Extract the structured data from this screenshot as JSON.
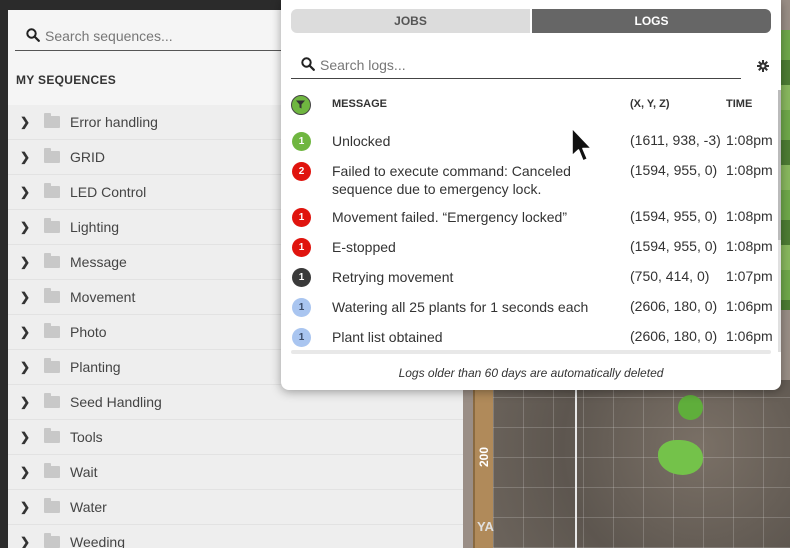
{
  "sequences": {
    "search_placeholder": "Search sequences...",
    "title": "MY SEQUENCES",
    "folders": [
      {
        "label": "Error handling"
      },
      {
        "label": "GRID"
      },
      {
        "label": "LED Control"
      },
      {
        "label": "Lighting"
      },
      {
        "label": "Message"
      },
      {
        "label": "Movement"
      },
      {
        "label": "Photo"
      },
      {
        "label": "Planting"
      },
      {
        "label": "Seed Handling"
      },
      {
        "label": "Tools"
      },
      {
        "label": "Wait"
      },
      {
        "label": "Water"
      },
      {
        "label": "Weeding"
      }
    ]
  },
  "map": {
    "axis_label": "200",
    "corner_label": "YA"
  },
  "logs_popup": {
    "tabs": {
      "jobs": "JOBS",
      "logs": "LOGS"
    },
    "active_tab": "logs",
    "search_placeholder": "Search logs...",
    "columns": {
      "message": "MESSAGE",
      "position": "(X, Y, Z)",
      "time": "TIME"
    },
    "rows": [
      {
        "level": "success",
        "verbosity": "1",
        "message": "Unlocked",
        "position": "(1611, 938, -3)",
        "time": "1:08pm"
      },
      {
        "level": "error",
        "verbosity": "2",
        "message": "Failed to execute command: Canceled sequence due to emergency lock.",
        "position": "(1594, 955, 0)",
        "time": "1:08pm"
      },
      {
        "level": "error",
        "verbosity": "1",
        "message": "Movement failed. “Emergency locked”",
        "position": "(1594, 955, 0)",
        "time": "1:08pm"
      },
      {
        "level": "error",
        "verbosity": "1",
        "message": "E-stopped",
        "position": "(1594, 955, 0)",
        "time": "1:08pm"
      },
      {
        "level": "busy",
        "verbosity": "1",
        "message": "Retrying movement",
        "position": "(750, 414, 0)",
        "time": "1:07pm"
      },
      {
        "level": "info",
        "verbosity": "1",
        "message": "Watering all 25 plants for 1 seconds each",
        "position": "(2606, 180, 0)",
        "time": "1:06pm"
      },
      {
        "level": "info",
        "verbosity": "1",
        "message": "Plant list obtained",
        "position": "(2606, 180, 0)",
        "time": "1:06pm"
      }
    ],
    "footer_note": "Logs older than 60 days are automatically deleted"
  },
  "icons": {
    "search": "search-icon",
    "settings": "gear-icon",
    "filter": "filter-icon",
    "folder": "folder-icon",
    "chevron": "chevron-right-icon",
    "cursor": "mouse-cursor-icon"
  },
  "colors": {
    "success": "#6fb640",
    "error": "#e0140e",
    "busy": "#3a3a3a",
    "info": "#a9c5f0",
    "tab_active": "#666666"
  }
}
